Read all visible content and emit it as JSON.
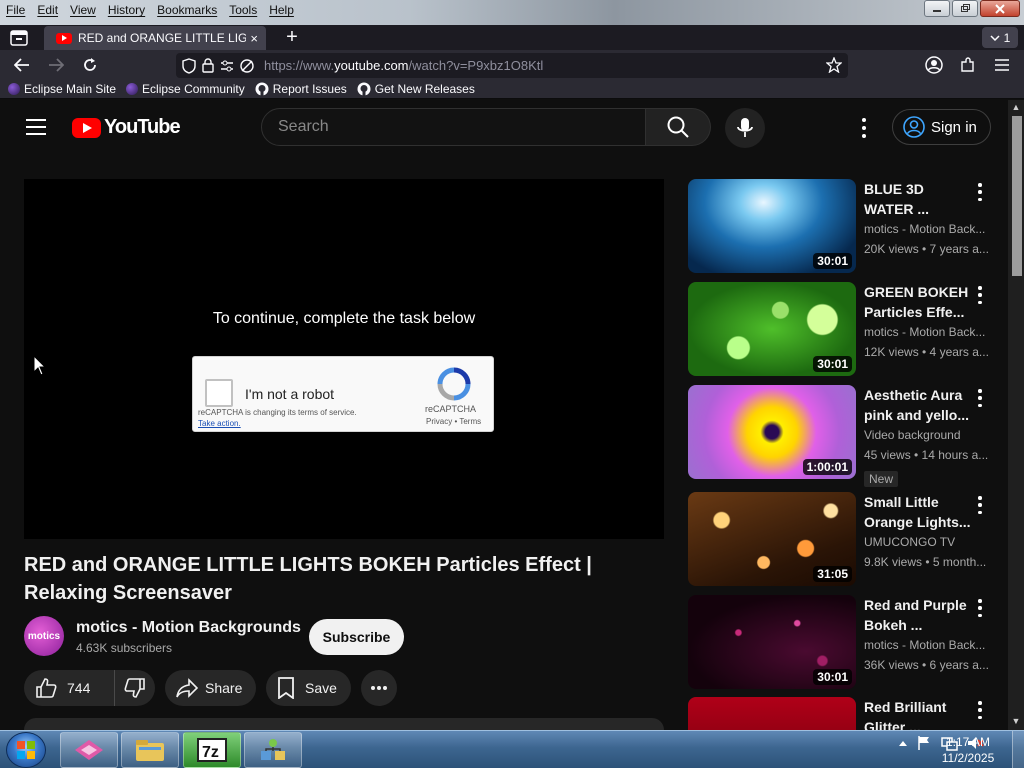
{
  "browser": {
    "menu": [
      "File",
      "Edit",
      "View",
      "History",
      "Bookmarks",
      "Tools",
      "Help"
    ],
    "tab_title": "RED and ORANGE LITTLE LIGHT",
    "tab_close": "×",
    "new_tab": "+",
    "tab_count": "1",
    "url_prefix": "https://www.",
    "url_host": "youtube.com",
    "url_path": "/watch?v=P9xbz1O8Ktl",
    "bookmarks": [
      "Eclipse Main Site",
      "Eclipse Community",
      "Report Issues",
      "Get New Releases"
    ]
  },
  "youtube": {
    "logo_text": "YouTube",
    "search_placeholder": "Search",
    "signin_label": "Sign in",
    "player_message": "To continue, complete the task below",
    "captcha": {
      "label": "I'm not a robot",
      "notice": "reCAPTCHA is changing its terms of service.",
      "take_action": "Take action.",
      "brand": "reCAPTCHA",
      "links": "Privacy • Terms"
    },
    "video_title": "RED and ORANGE LITTLE LIGHTS BOKEH Particles Effect | Relaxing Screensaver",
    "channel": {
      "avatar_text": "motics",
      "name": "motics - Motion Backgrounds",
      "subscribers": "4.63K subscribers",
      "subscribe_label": "Subscribe"
    },
    "actions": {
      "likes": "744",
      "share": "Share",
      "save": "Save"
    },
    "related": [
      {
        "title": "BLUE 3D WATER ...",
        "channel": "motics - Motion Back...",
        "meta": "20K views • 7 years a...",
        "duration": "30:01"
      },
      {
        "title": "GREEN BOKEH Particles Effe...",
        "channel": "motics - Motion Back...",
        "meta": "12K views • 4 years a...",
        "duration": "30:01"
      },
      {
        "title": "Aesthetic Aura pink and yello...",
        "channel": "Video background",
        "meta": "45 views • 14 hours a...",
        "duration": "1:00:01",
        "badge": "New"
      },
      {
        "title": "Small Little Orange Lights...",
        "channel": "UMUCONGO TV",
        "meta": "9.8K views • 5 month...",
        "duration": "31:05"
      },
      {
        "title": "Red and Purple Bokeh ...",
        "channel": "motics - Motion Back...",
        "meta": "36K views • 6 years a...",
        "duration": "30:01"
      },
      {
        "title": "Red Brilliant Glitter ...",
        "channel": "",
        "meta": "",
        "duration": ""
      }
    ]
  },
  "taskbar": {
    "time": "1:17 AM",
    "date": "11/2/2025"
  },
  "colors": {
    "youtube_red": "#ff0000",
    "page_bg": "#0f0f0f",
    "firefox_toolbar": "#2b2a33"
  }
}
